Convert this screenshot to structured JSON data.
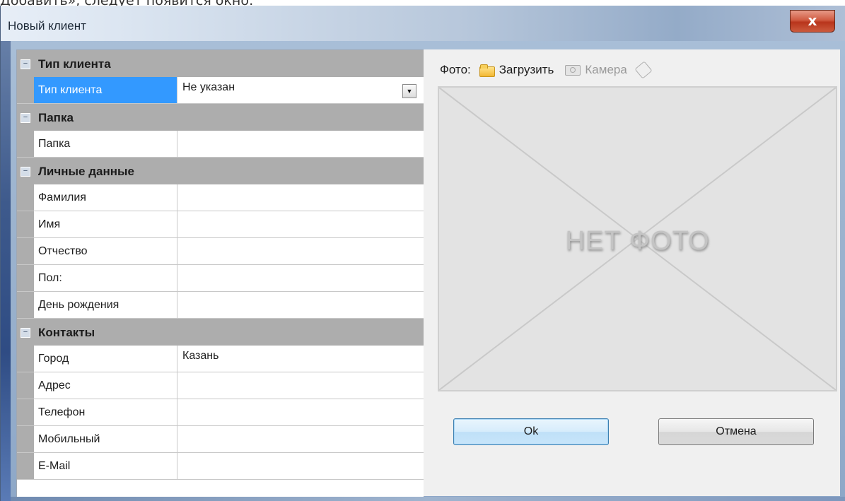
{
  "background_caption": "Добавить», следует появится окно:",
  "window": {
    "title": "Новый клиент",
    "close_label": "x"
  },
  "property_grid": {
    "toggle_symbol": "−",
    "categories": [
      {
        "name": "Тип клиента",
        "props": [
          {
            "label": "Тип клиента",
            "value": "Не указан",
            "selected": true,
            "has_dropdown": true
          }
        ]
      },
      {
        "name": "Папка",
        "props": [
          {
            "label": "Папка",
            "value": ""
          }
        ]
      },
      {
        "name": "Личные данные",
        "props": [
          {
            "label": "Фамилия",
            "value": ""
          },
          {
            "label": "Имя",
            "value": ""
          },
          {
            "label": "Отчество",
            "value": ""
          },
          {
            "label": "Пол:",
            "value": ""
          },
          {
            "label": "День рождения",
            "value": ""
          }
        ]
      },
      {
        "name": "Контакты",
        "props": [
          {
            "label": "Город",
            "value": "Казань"
          },
          {
            "label": "Адрес",
            "value": ""
          },
          {
            "label": "Телефон",
            "value": ""
          },
          {
            "label": "Мобильный",
            "value": ""
          },
          {
            "label": "E-Mail",
            "value": ""
          }
        ]
      }
    ],
    "dropdown_glyph": "▼"
  },
  "photo": {
    "label": "Фото:",
    "upload_label": "Загрузить",
    "camera_label": "Камера",
    "placeholder_text": "НЕТ ФОТО",
    "icons": [
      "folder-icon",
      "camera-icon",
      "eraser-icon"
    ]
  },
  "buttons": {
    "ok": "Ok",
    "cancel": "Отмена"
  },
  "colors": {
    "selection": "#3399ff",
    "category_bg": "#adadad",
    "close_button": "#c44a30"
  }
}
